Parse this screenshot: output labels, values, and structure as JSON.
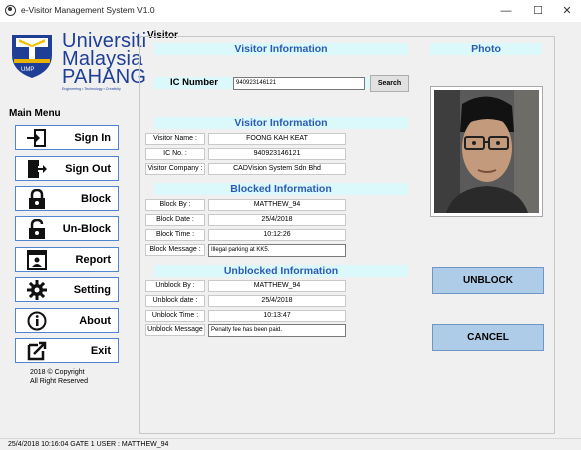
{
  "window": {
    "title": "e-Visitor Management System V1.0",
    "minimize": "—",
    "maximize": "☐",
    "close": "✕"
  },
  "logo": {
    "line1": "Universiti",
    "line2": "Malaysia",
    "line3": "PAHANG",
    "tagline": "Engineering • Technology • Creativity",
    "shield_text": "UMP",
    "brand_color": "#1f3f97"
  },
  "menu": {
    "heading": "Main Menu",
    "items": [
      {
        "label": "Sign In",
        "icon": "sign-in-icon"
      },
      {
        "label": "Sign Out",
        "icon": "sign-out-icon"
      },
      {
        "label": "Block",
        "icon": "lock-icon"
      },
      {
        "label": "Un-Block",
        "icon": "unlock-icon"
      },
      {
        "label": "Report",
        "icon": "report-icon"
      },
      {
        "label": "Setting",
        "icon": "gear-icon"
      },
      {
        "label": "About",
        "icon": "info-icon"
      },
      {
        "label": "Exit",
        "icon": "exit-icon"
      }
    ]
  },
  "copyright": {
    "line1": "2018 © Copyright",
    "line2": "All Right Reserved"
  },
  "visitor": {
    "section_title": "Visitor",
    "header": "Visitor Information",
    "ic_label": "IC Number",
    "ic_value": "940923146121",
    "search_label": "Search",
    "info_header": "Visitor Information",
    "name_label": "Visitor Name :",
    "name_value": "FOONG KAH KEAT",
    "ic_no_label": "IC No. :",
    "ic_no_value": "940923146121",
    "company_label": "Visitor Company :",
    "company_value": "CADVision System Sdn Bhd"
  },
  "blocked": {
    "header": "Blocked Information",
    "by_label": "Block By :",
    "by_value": "MATTHEW_94",
    "date_label": "Block Date :",
    "date_value": "25/4/2018",
    "time_label": "Block Time :",
    "time_value": "10:12:26",
    "message_label": "Block Message :",
    "message_value": "Illegal parking at KK5."
  },
  "unblocked": {
    "header": "Unblocked Information",
    "by_label": "Unblock By :",
    "by_value": "MATTHEW_94",
    "date_label": "Unblock date :",
    "date_value": "25/4/2018",
    "time_label": "Unblock Time :",
    "time_value": "10:13:47",
    "message_label": "Unblock Message",
    "message_value": "Penalty fee has been paid."
  },
  "photo": {
    "header": "Photo"
  },
  "actions": {
    "unblock_label": "UNBLOCK",
    "cancel_label": "CANCEL"
  },
  "status": {
    "text": "25/4/2018  10:16:04   GATE 1   USER : MATTHEW_94"
  },
  "colors": {
    "band_bg": "#dbf8fb",
    "band_text": "#2b5bb5",
    "menu_border": "#4f85d1",
    "action_bg": "#aecbe8"
  }
}
